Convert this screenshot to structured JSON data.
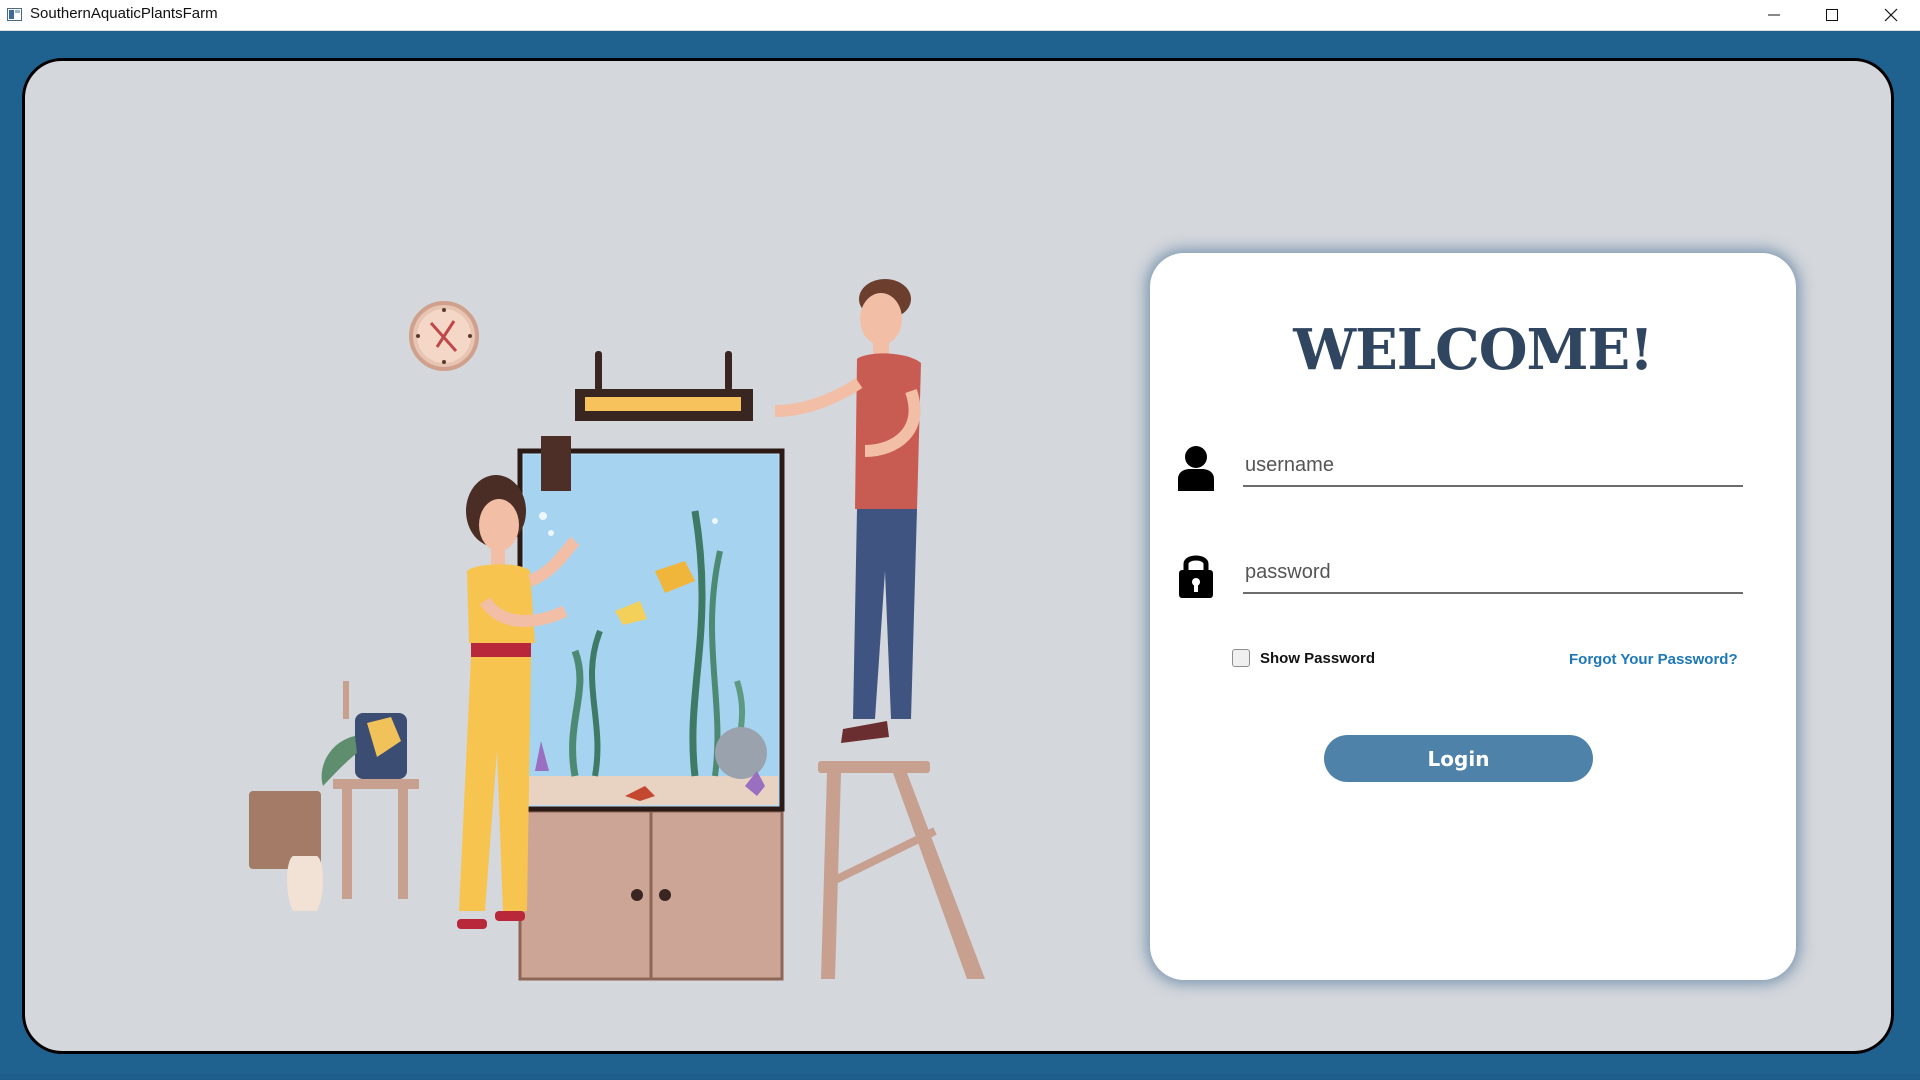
{
  "window": {
    "title": "SouthernAquaticPlantsFarm",
    "controls": [
      "minimize-icon",
      "maximize-icon",
      "close-icon"
    ]
  },
  "login": {
    "heading": "WELCOME!",
    "username_placeholder": "username",
    "username_value": "",
    "password_placeholder": "password",
    "password_value": "",
    "show_password_label": "Show Password",
    "show_password_checked": false,
    "forgot_password_label": "Forgot Your Password?",
    "login_label": "Login"
  },
  "icons": {
    "username": "user-icon",
    "password": "lock-icon"
  },
  "colors": {
    "window_frame": "#20628f",
    "panel": "#d4d7dc",
    "heading": "#2f4560",
    "login_button": "#4f82a8",
    "link": "#1c78b7"
  }
}
